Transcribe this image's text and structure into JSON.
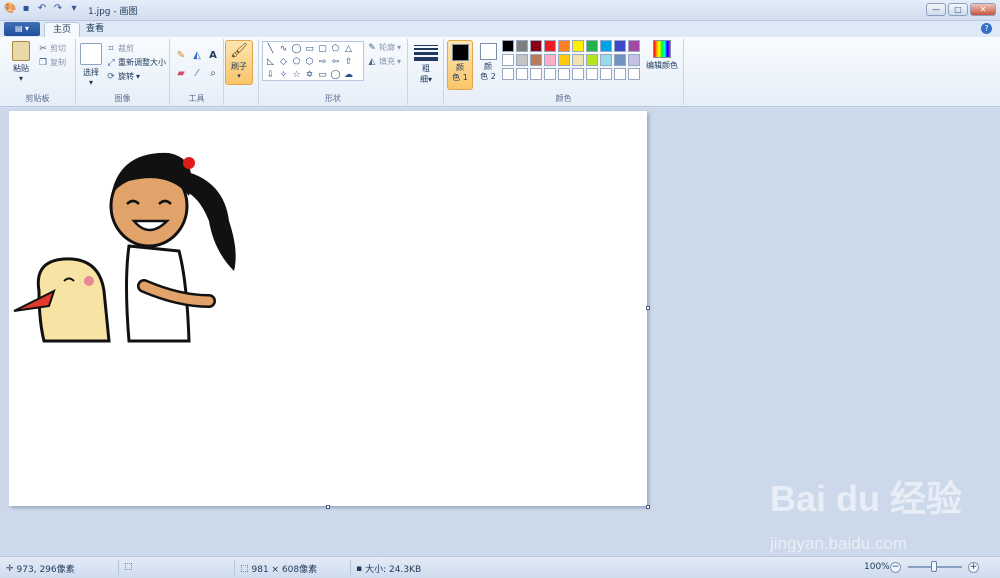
{
  "window": {
    "title": "1.jpg - 画图"
  },
  "tabs": [
    {
      "label": "主页"
    },
    {
      "label": "查看"
    }
  ],
  "ribbon": {
    "clipboard": {
      "paste": "粘贴",
      "cut": "剪切",
      "copy": "复制",
      "group": "剪贴板"
    },
    "image": {
      "select": "选择",
      "crop": "裁剪",
      "resize": "重新调整大小",
      "rotate": "旋转",
      "group": "图像"
    },
    "tools": {
      "group": "工具"
    },
    "brush": {
      "label": "刷子"
    },
    "shapes": {
      "outline": "轮廓",
      "fill": "填充",
      "group": "形状"
    },
    "size": {
      "label_top": "粗",
      "label_bottom": "细"
    },
    "color1": {
      "label_top": "颜",
      "label_bottom": "色 1",
      "color": "#000000"
    },
    "color2": {
      "label_top": "颜",
      "label_bottom": "色 2",
      "color": "#ffffff"
    },
    "colors": {
      "group": "颜色",
      "edit": "编辑颜色"
    }
  },
  "palette": [
    "#000000",
    "#7f7f7f",
    "#880015",
    "#ed1c24",
    "#ff7f27",
    "#fff200",
    "#22b14c",
    "#00a2e8",
    "#3f48cc",
    "#a349a4",
    "#ffffff",
    "#c3c3c3",
    "#b97a57",
    "#ffaec9",
    "#ffc90e",
    "#efe4b0",
    "#b5e61d",
    "#99d9ea",
    "#7092be",
    "#c8bfe7",
    "#ffffff",
    "#ffffff",
    "#ffffff",
    "#ffffff",
    "#ffffff",
    "#ffffff",
    "#ffffff",
    "#ffffff",
    "#ffffff",
    "#ffffff"
  ],
  "status": {
    "cursor": "973, 296像素",
    "dimensions": "981 × 608像素",
    "size": "大小: 24.3KB",
    "zoom": "100%"
  },
  "watermark": {
    "brand": "Bai du 经验",
    "url": "jingyan.baidu.com"
  }
}
